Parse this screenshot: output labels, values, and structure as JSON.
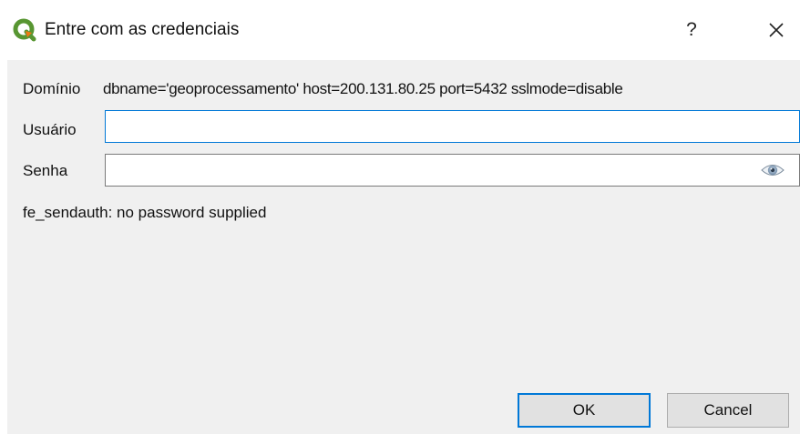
{
  "window": {
    "title": "Entre com as credenciais",
    "help_label": "?",
    "icon": "qgis-logo-icon"
  },
  "form": {
    "domain_label": "Domínio",
    "domain_value": "dbname='geoprocessamento' host=200.131.80.25 port=5432 sslmode=disable",
    "user_label": "Usuário",
    "user_value": "",
    "password_label": "Senha",
    "password_value": "",
    "error_message": "fe_sendauth: no password supplied"
  },
  "buttons": {
    "ok_label": "OK",
    "cancel_label": "Cancel"
  },
  "colors": {
    "accent": "#0078d7",
    "qgis_green": "#589632",
    "qgis_yellow": "#ee7913",
    "background": "#f0f0f0"
  }
}
